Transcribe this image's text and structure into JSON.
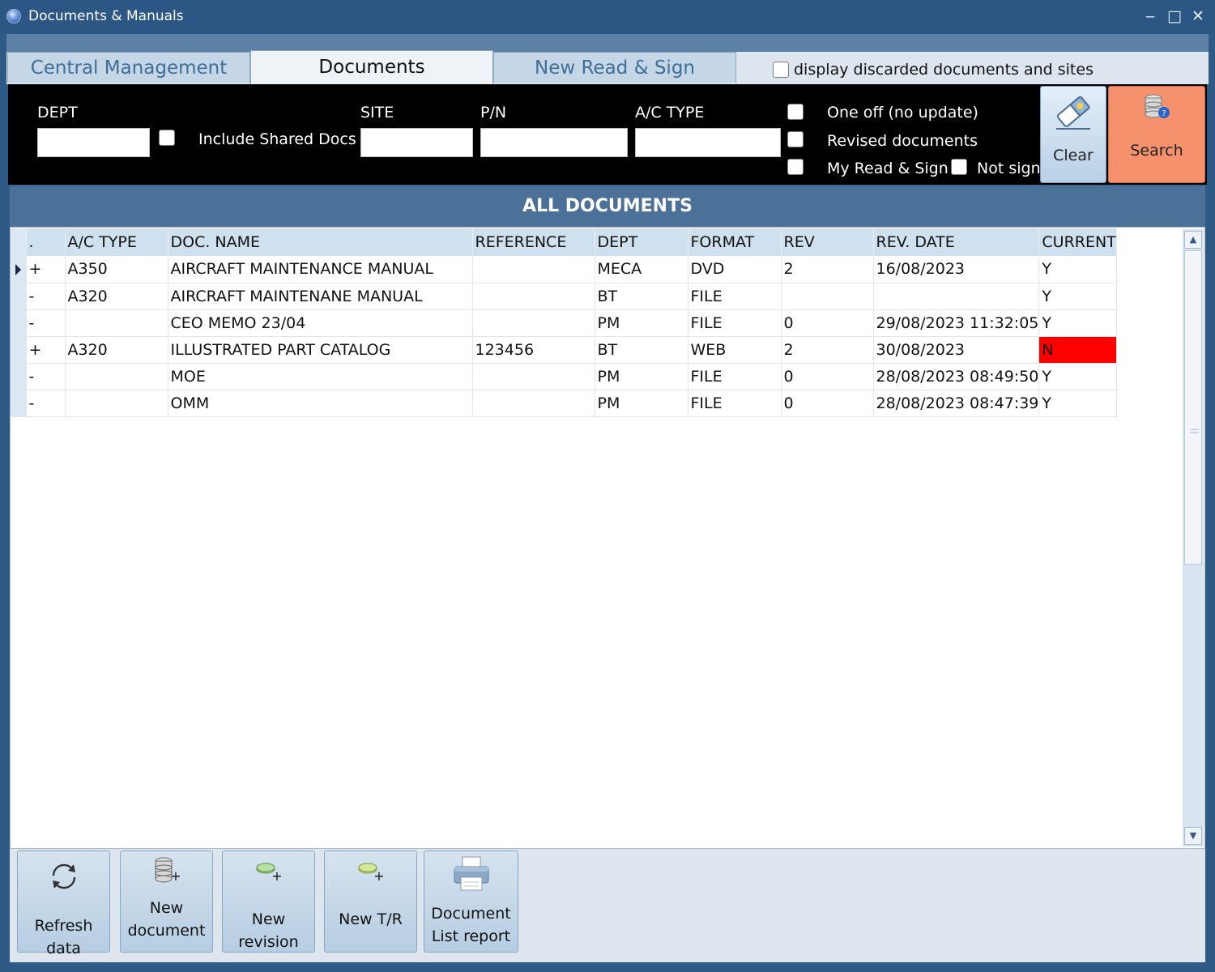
{
  "window": {
    "title": "Documents & Manuals",
    "minimize": "‒",
    "maximize": "□",
    "close": "✕"
  },
  "tabs": [
    {
      "label": "Central Management",
      "active": false
    },
    {
      "label": "Documents",
      "active": true
    },
    {
      "label": "New Read & Sign",
      "active": false
    }
  ],
  "display_discarded": {
    "label": "display discarded documents and sites",
    "checked": false
  },
  "filters": {
    "dept_label": "DEPT",
    "include_shared_label": "Include Shared Docs",
    "site_label": "SITE",
    "pn_label": "P/N",
    "actype_label": "A/C TYPE",
    "one_off_label": "One off (no update)",
    "revised_label": "Revised documents",
    "my_read_sign_label": "My Read & Sign",
    "not_signed_label": "Not signed"
  },
  "buttons": {
    "clear": "Clear",
    "search": "Search"
  },
  "section_title": "ALL DOCUMENTS",
  "grid": {
    "columns": [
      ".",
      "A/C TYPE",
      "DOC. NAME",
      "REFERENCE",
      "DEPT",
      "FORMAT",
      "REV",
      "REV. DATE",
      "CURRENT"
    ],
    "rows": [
      {
        "expand": "+",
        "ac_type": "A350",
        "doc_name": "AIRCRAFT MAINTENANCE MANUAL",
        "reference": "",
        "dept": "MECA",
        "format": "DVD",
        "rev": "2",
        "rev_date": "16/08/2023",
        "current": "Y"
      },
      {
        "expand": "-",
        "ac_type": "A320",
        "doc_name": "AIRCRAFT MAINTENANE MANUAL",
        "reference": "",
        "dept": "BT",
        "format": "FILE",
        "rev": "",
        "rev_date": "",
        "current": "Y"
      },
      {
        "expand": "-",
        "ac_type": "",
        "doc_name": "CEO MEMO 23/04",
        "reference": "",
        "dept": "PM",
        "format": "FILE",
        "rev": "0",
        "rev_date": "29/08/2023 11:32:05",
        "current": "Y"
      },
      {
        "expand": "+",
        "ac_type": "A320",
        "doc_name": "ILLUSTRATED PART CATALOG",
        "reference": "123456",
        "dept": "BT",
        "format": "WEB",
        "rev": "2",
        "rev_date": "30/08/2023",
        "current": "N"
      },
      {
        "expand": "-",
        "ac_type": "",
        "doc_name": "MOE",
        "reference": "",
        "dept": "PM",
        "format": "FILE",
        "rev": "0",
        "rev_date": "28/08/2023 08:49:50",
        "current": "Y"
      },
      {
        "expand": "-",
        "ac_type": "",
        "doc_name": "OMM",
        "reference": "",
        "dept": "PM",
        "format": "FILE",
        "rev": "0",
        "rev_date": "28/08/2023 08:47:39",
        "current": "Y"
      }
    ]
  },
  "actions": {
    "refresh": "Refresh data",
    "new_document_1": "New",
    "new_document_2": "document",
    "new_revision": "New revision",
    "new_tr": "New T/R",
    "doc_list_1": "Document",
    "doc_list_2": "List report"
  },
  "colors": {
    "accent": "#4c7199",
    "search": "#f5916c",
    "current_no": "#ff0000"
  }
}
